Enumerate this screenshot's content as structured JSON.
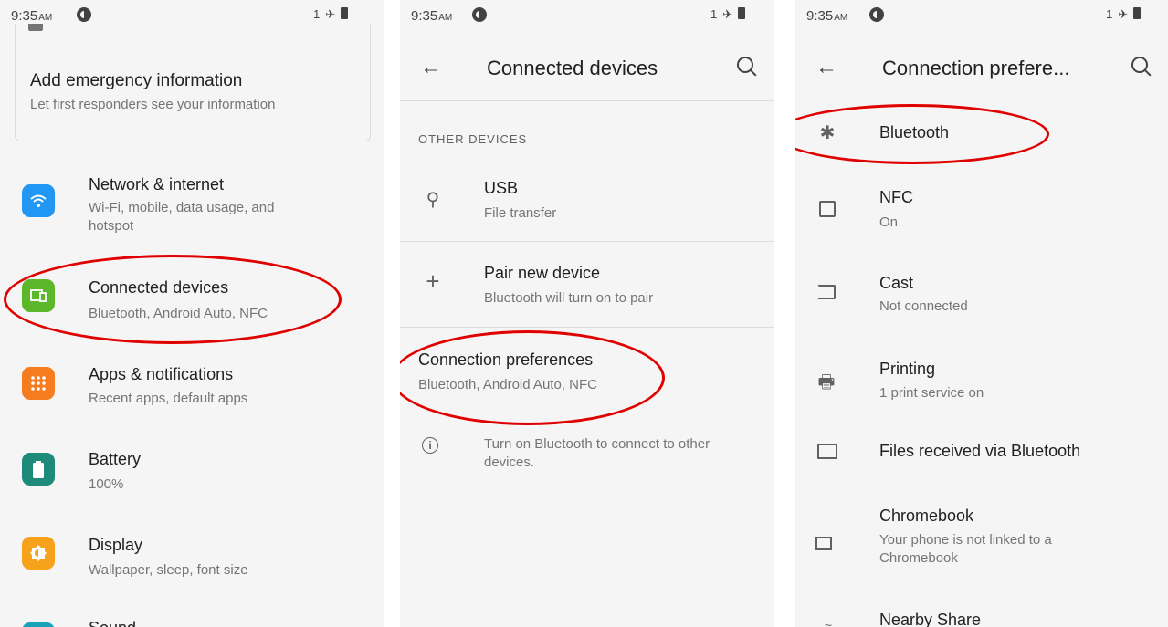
{
  "status": {
    "time": "9:35",
    "ampm": "AM",
    "sim_indicator": "1"
  },
  "screen1": {
    "emergency": {
      "title": "Add emergency information",
      "subtitle": "Let first responders see your information"
    },
    "items": [
      {
        "title": "Network & internet",
        "subtitle": "Wi-Fi, mobile, data usage, and hotspot",
        "icon": "wifi-icon",
        "color": "#2196f3"
      },
      {
        "title": "Connected devices",
        "subtitle": "Bluetooth, Android Auto, NFC",
        "icon": "connected-devices-icon",
        "color": "#5cb82a"
      },
      {
        "title": "Apps & notifications",
        "subtitle": "Recent apps, default apps",
        "icon": "apps-grid-icon",
        "color": "#f57c1f"
      },
      {
        "title": "Battery",
        "subtitle": "100%",
        "icon": "battery-icon",
        "color": "#1e8a7a"
      },
      {
        "title": "Display",
        "subtitle": "Wallpaper, sleep, font size",
        "icon": "brightness-icon",
        "color": "#f7a21b"
      },
      {
        "title": "Sound",
        "icon": "sound-icon",
        "color": "#1aa3b8"
      }
    ]
  },
  "screen2": {
    "title": "Connected devices",
    "section_header": "OTHER DEVICES",
    "usb": {
      "title": "USB",
      "subtitle": "File transfer",
      "icon": "usb-icon"
    },
    "pair": {
      "title": "Pair new device",
      "subtitle": "Bluetooth will turn on to pair",
      "icon": "plus-icon"
    },
    "prefs": {
      "title": "Connection preferences",
      "subtitle": "Bluetooth, Android Auto, NFC"
    },
    "info": {
      "text": "Turn on Bluetooth to connect to other devices.",
      "icon": "info-icon"
    }
  },
  "screen3": {
    "title": "Connection prefere...",
    "items": [
      {
        "title": "Bluetooth",
        "icon": "bluetooth-icon"
      },
      {
        "title": "NFC",
        "subtitle": "On",
        "icon": "nfc-icon"
      },
      {
        "title": "Cast",
        "subtitle": "Not connected",
        "icon": "cast-icon"
      },
      {
        "title": "Printing",
        "subtitle": "1 print service on",
        "icon": "printer-icon"
      },
      {
        "title": "Files received via Bluetooth",
        "icon": "folder-icon"
      },
      {
        "title": "Chromebook",
        "subtitle": "Your phone is not linked to a Chromebook",
        "icon": "chromebook-icon"
      },
      {
        "title": "Nearby Share",
        "icon": "nearby-share-icon"
      }
    ]
  },
  "colors": {
    "highlight_ring": "#e00000",
    "background": "#f5f5f5"
  }
}
